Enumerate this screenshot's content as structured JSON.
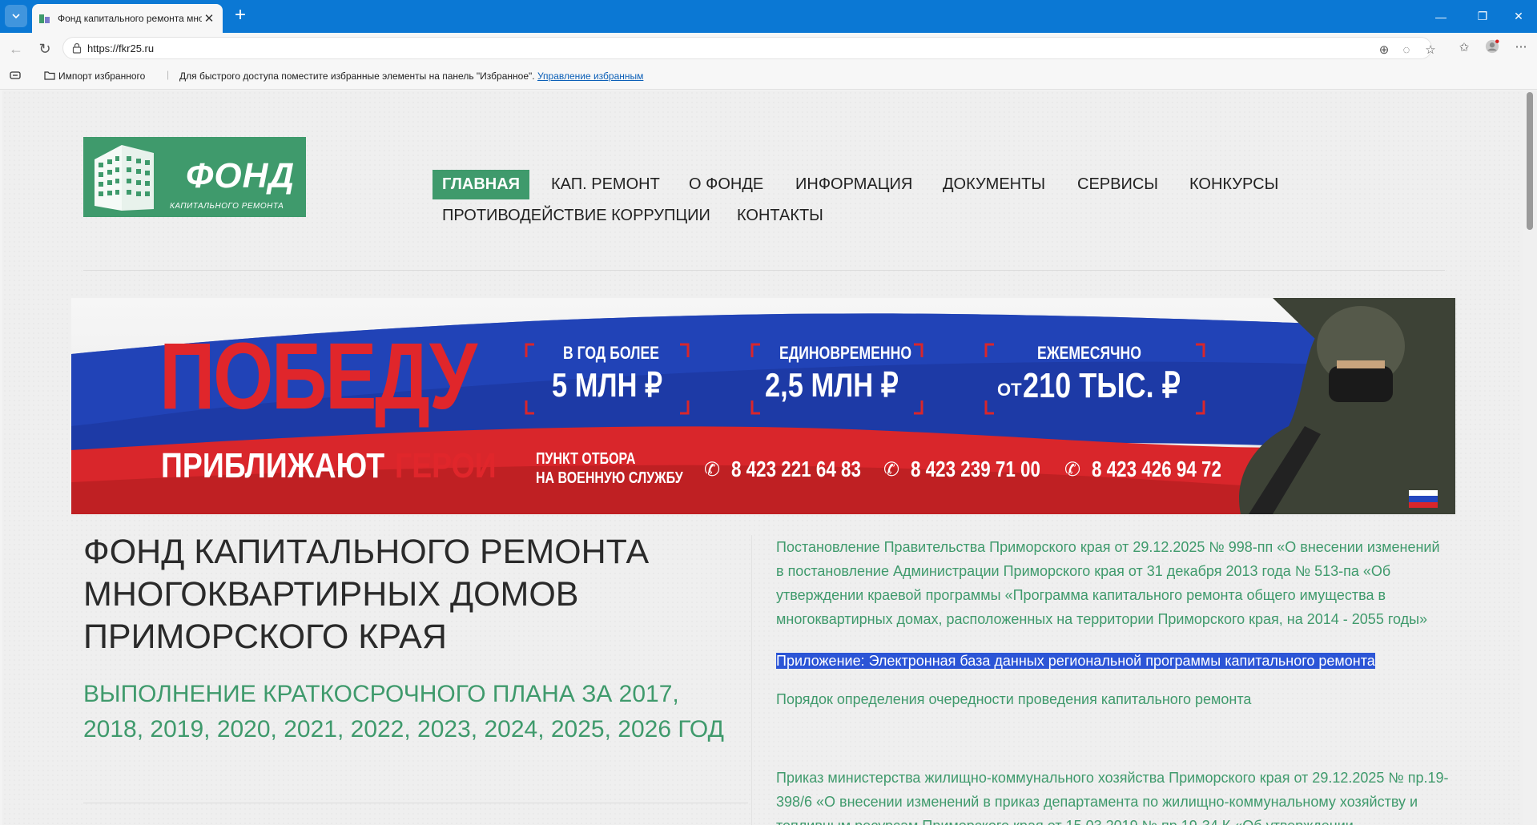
{
  "browser": {
    "tab_title": "Фонд капитального ремонта мно",
    "url": "https://fkr25.ru",
    "favbar": {
      "import_label": "Импорт избранного",
      "hint": "Для быстрого доступа поместите избранные элементы на панель \"Избранное\".",
      "manage_link": "Управление избранным"
    }
  },
  "site": {
    "logo": {
      "word": "ФОНД",
      "sub": "КАПИТАЛЬНОГО РЕМОНТА"
    },
    "menu": [
      "ГЛАВНАЯ",
      "КАП. РЕМОНТ",
      "О ФОНДЕ",
      "ИНФОРМАЦИЯ",
      "ДОКУМЕНТЫ",
      "СЕРВИСЫ",
      "КОНКУРСЫ",
      "ПРОТИВОДЕЙСТВИЕ КОРРУПЦИИ",
      "КОНТАКТЫ"
    ],
    "banner": {
      "big": "ПОБЕДУ",
      "line2a": "ПРИБЛИЖАЮТ",
      "line2b": "ГЕРОИ",
      "box1_top": "В ГОД БОЛЕЕ",
      "box1_val": "5 МЛН ₽",
      "box2_top": "ЕДИНОВРЕМЕННО",
      "box2_val": "2,5 МЛН ₽",
      "box3_top": "ЕЖЕМЕСЯЧНО",
      "box3_pre": "ОТ",
      "box3_val": "210 ТЫС. ₽",
      "point1": "ПУНКТ ОТБОРА",
      "point2": "НА ВОЕННУЮ СЛУЖБУ",
      "phone1": "8 423 221 64 83",
      "phone2": "8 423 239 71 00",
      "phone3": "8 423 426 94 72"
    },
    "heading": "ФОНД КАПИТАЛЬНОГО РЕМОНТА МНОГОКВАРТИРНЫХ ДОМОВ ПРИМОРСКОГО КРАЯ",
    "subheading": "ВЫПОЛНЕНИЕ КРАТКОСРОЧНОГО ПЛАНА ЗА 2017, 2018, 2019, 2020, 2021, 2022, 2023, 2024, 2025, 2026 ГОД",
    "news": [
      "Постановление Правительства Приморского края от 29.12.2025 № 998-пп «О внесении изменений в постановление Администрации Приморского края от 31 декабря 2013 года № 513-па «Об утверждении краевой программы «Программа капитального ремонта общего имущества в многоквартирных домах, расположенных на территории Приморского края, на 2014 - 2055 годы»",
      "Приложение: Электронная база данных региональной программы капитального ремонта",
      "Порядок определения очередности проведения капитального ремонта",
      "Приказ министерства жилищно-коммунального хозяйства Приморского края от 29.12.2025 № пр.19-398/6 «О внесении изменений в приказ департамента по жилищно-коммунальному хозяйству и топливным ресурсам Приморского края от 15.03.2019 № пр.19-34 К «Об утверждении"
    ]
  },
  "colors": {
    "brand_green": "#3f9a6c",
    "titlebar": "#0b78d4",
    "highlight": "#2c55d6"
  }
}
